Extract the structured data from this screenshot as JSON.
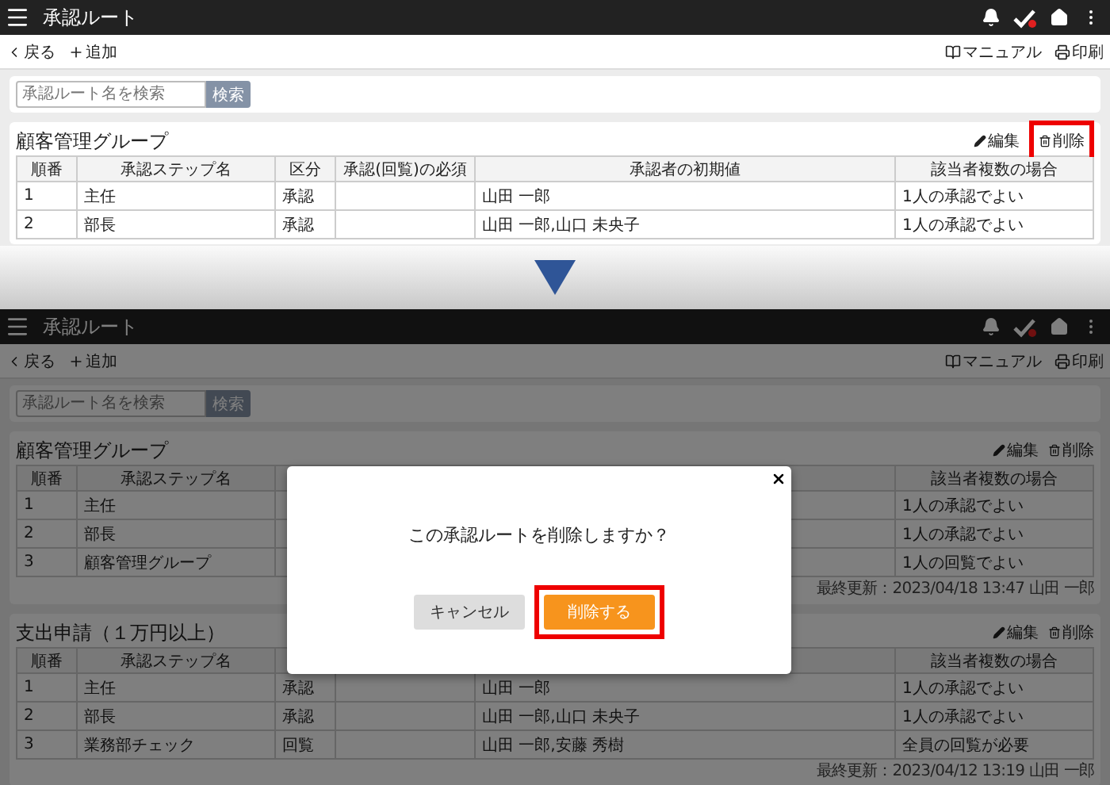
{
  "screens": [
    {
      "dimmed": false,
      "header": {
        "title": "承認ルート"
      },
      "toolbar": {
        "back": "戻る",
        "add": "追加",
        "manual": "マニュアル",
        "print": "印刷"
      },
      "search": {
        "placeholder": "承認ルート名を検索",
        "button": "検索"
      },
      "groups": [
        {
          "title": "顧客管理グループ",
          "edit": "編集",
          "delete": {
            "label": "削除",
            "highlighted": true
          },
          "columns": [
            "順番",
            "承認ステップ名",
            "区分",
            "承認(回覧)の必須",
            "承認者の初期値",
            "該当者複数の場合"
          ],
          "rows": [
            [
              "1",
              "主任",
              "承認",
              null,
              "山田 一郎",
              "1人の承認でよい"
            ],
            [
              "2",
              "部長",
              "承認",
              null,
              "山田 一郎,山口 未央子",
              "1人の承認でよい"
            ]
          ]
        }
      ]
    },
    {
      "dimmed": true,
      "header": {
        "title": "承認ルート"
      },
      "toolbar": {
        "back": "戻る",
        "add": "追加",
        "manual": "マニュアル",
        "print": "印刷"
      },
      "search": {
        "placeholder": "承認ルート名を検索",
        "button": "検索"
      },
      "groups": [
        {
          "title": "顧客管理グループ",
          "edit": "編集",
          "delete": {
            "label": "削除",
            "highlighted": false
          },
          "columns": [
            "順番",
            "承認ステップ名",
            null,
            null,
            null,
            "該当者複数の場合"
          ],
          "rows": [
            [
              "1",
              "主任",
              null,
              null,
              null,
              "1人の承認でよい"
            ],
            [
              "2",
              "部長",
              null,
              null,
              null,
              "1人の承認でよい"
            ],
            [
              "3",
              "顧客管理グループ",
              null,
              null,
              null,
              "1人の回覧でよい"
            ]
          ],
          "updated": "最終更新：2023/04/18 13:47 山田 一郎"
        },
        {
          "title": "支出申請（１万円以上）",
          "edit": "編集",
          "delete": {
            "label": "削除",
            "highlighted": false
          },
          "columns": [
            "順番",
            "承認ステップ名",
            null,
            null,
            null,
            "該当者複数の場合"
          ],
          "rows": [
            [
              "1",
              "主任",
              "承認",
              null,
              "山田 一郎",
              "1人の承認でよい"
            ],
            [
              "2",
              "部長",
              "承認",
              null,
              "山田 一郎,山口 未央子",
              "1人の承認でよい"
            ],
            [
              "3",
              "業務部チェック",
              "回覧",
              null,
              "山田 一郎,安藤 秀樹",
              "全員の回覧が必要"
            ]
          ],
          "updated": "最終更新：2023/04/12 13:19 山田 一郎"
        }
      ],
      "dialog": {
        "message": "この承認ルートを削除しますか？",
        "cancel": "キャンセル",
        "confirm": {
          "label": "削除する",
          "highlighted": true
        }
      }
    }
  ]
}
